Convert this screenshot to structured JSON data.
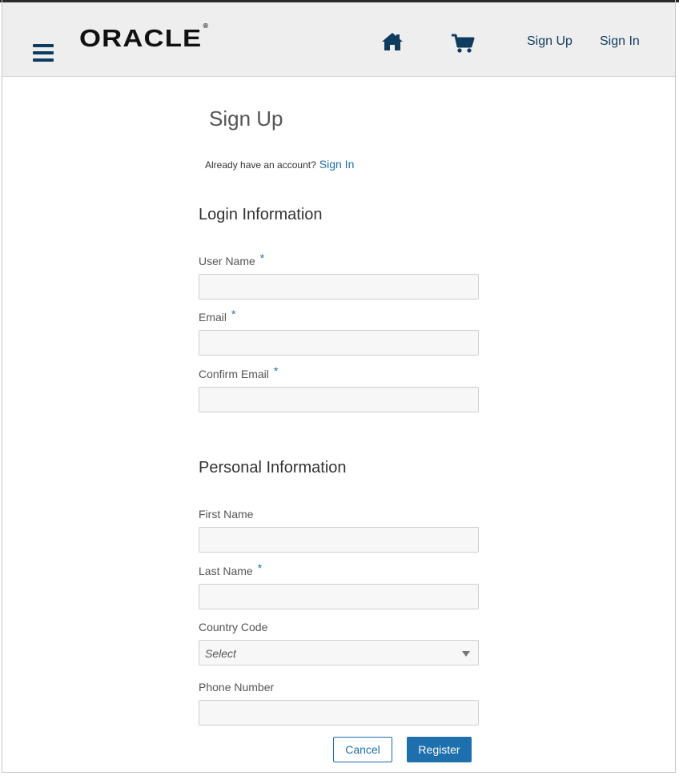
{
  "header": {
    "logo_text": "ORACLE",
    "logo_mark": "®",
    "icons": {
      "menu": "hamburger-icon",
      "home": "home-icon",
      "cart": "shopping-cart-icon"
    },
    "nav": {
      "sign_up": "Sign Up",
      "sign_in": "Sign In"
    }
  },
  "page": {
    "title": "Sign Up",
    "already_text": "Already have an account?",
    "sign_in_link": "Sign In"
  },
  "login_section": {
    "title": "Login Information",
    "fields": {
      "user_name": {
        "label": "User Name",
        "required": "*",
        "value": ""
      },
      "email": {
        "label": "Email",
        "required": "*",
        "value": ""
      },
      "confirm_email": {
        "label": "Confirm Email",
        "required": "*",
        "value": ""
      }
    }
  },
  "personal_section": {
    "title": "Personal Information",
    "fields": {
      "first_name": {
        "label": "First Name",
        "value": ""
      },
      "last_name": {
        "label": "Last Name",
        "required": "*",
        "value": ""
      },
      "country_code": {
        "label": "Country Code",
        "selected": "Select"
      },
      "phone_number": {
        "label": "Phone Number",
        "value": ""
      }
    }
  },
  "actions": {
    "cancel": "Cancel",
    "register": "Register"
  },
  "colors": {
    "accent": "#1d6fae",
    "nav": "#0f3b5f",
    "header_bg": "#eeeeee"
  }
}
